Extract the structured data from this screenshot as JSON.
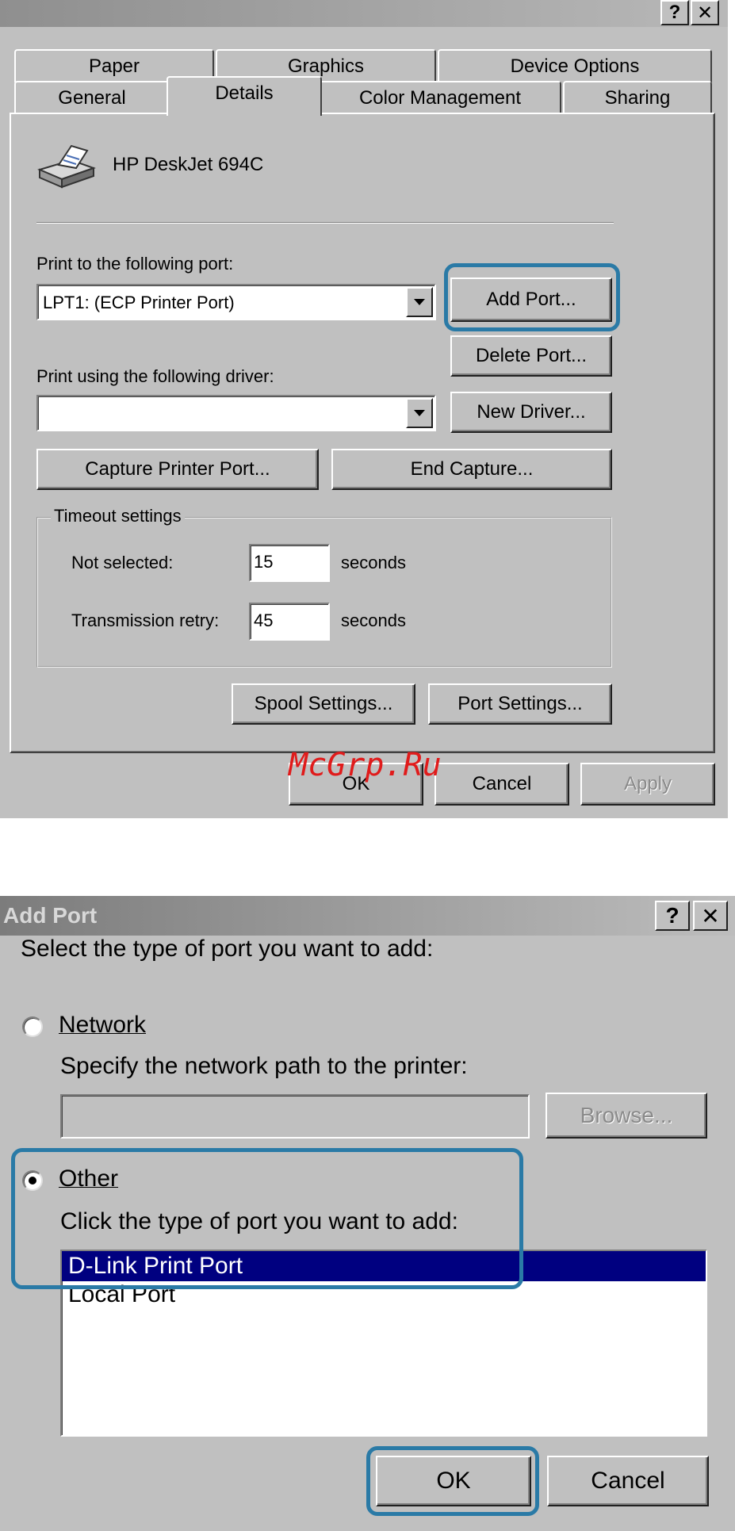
{
  "dialog1": {
    "title_help": "?",
    "title_close": "✕",
    "tabs_back": [
      "Paper",
      "Graphics",
      "Device Options"
    ],
    "tabs_front": [
      "General",
      "Details",
      "Color Management",
      "Sharing"
    ],
    "printer_name": "HP DeskJet 694C",
    "printer_icon": "printer-icon",
    "port_label": "Print to the following port:",
    "port_value": "LPT1:  (ECP Printer Port)",
    "add_port": "Add Port...",
    "delete_port": "Delete Port...",
    "driver_label": "Print using the following driver:",
    "driver_value": "",
    "new_driver": "New Driver...",
    "capture_port": "Capture Printer Port...",
    "end_capture": "End Capture...",
    "timeout_legend": "Timeout settings",
    "not_selected_label": "Not selected:",
    "not_selected_value": "15",
    "retry_label": "Transmission retry:",
    "retry_value": "45",
    "seconds": "seconds",
    "spool_settings": "Spool Settings...",
    "port_settings": "Port Settings...",
    "ok": "OK",
    "cancel": "Cancel",
    "apply": "Apply"
  },
  "watermark": "McGrp.Ru",
  "dialog2": {
    "title": "Add Port",
    "title_help": "?",
    "title_close": "✕",
    "prompt": "Select the type of port you want to add:",
    "network_label": "Network",
    "network_hint": "Specify the network path to the printer:",
    "network_path": "",
    "browse": "Browse...",
    "other_label": "Other",
    "other_hint": "Click the type of port you want to add:",
    "port_types": [
      "D-Link Print Port",
      "Local Port"
    ],
    "ok": "OK",
    "cancel": "Cancel"
  },
  "colors": {
    "highlight": "#2a7aa6",
    "selection": "#000080",
    "dialog_bg": "#c0c0c0",
    "watermark": "#e01b1b"
  }
}
